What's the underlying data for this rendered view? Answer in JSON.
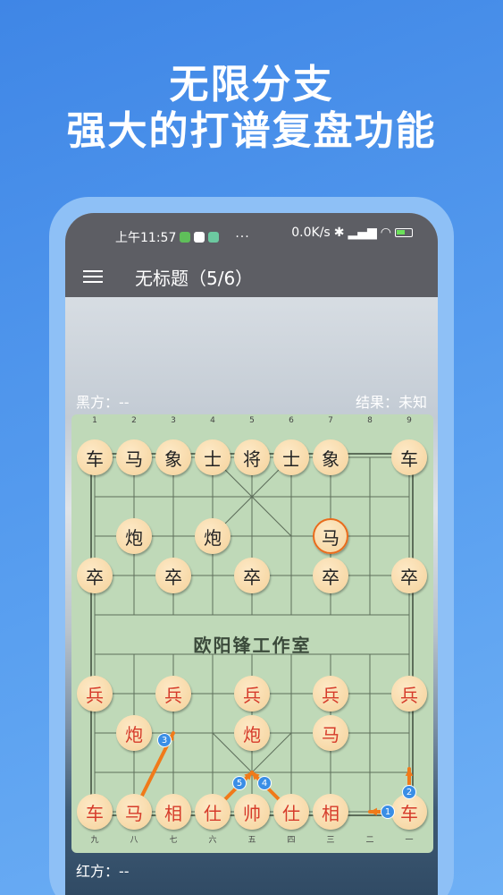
{
  "promo": {
    "line1": "无限分支",
    "line2": "强大的打谱复盘功能"
  },
  "statusbar": {
    "time": "上午11:57",
    "dots": "···",
    "speed": "0.0K/s"
  },
  "appbar": {
    "title": "无标题（5/6）"
  },
  "game": {
    "black_label": "黑方：--",
    "result_label": "结果：未知",
    "red_label": "红方：--",
    "river_text": "欧阳锋工作室"
  },
  "board": {
    "top_files": [
      "1",
      "2",
      "3",
      "4",
      "5",
      "6",
      "7",
      "8",
      "9"
    ],
    "bottom_files": [
      "九",
      "八",
      "七",
      "六",
      "五",
      "四",
      "三",
      "二",
      "一"
    ],
    "black_pieces": [
      {
        "char": "车",
        "file": 0,
        "rank": 0
      },
      {
        "char": "马",
        "file": 1,
        "rank": 0
      },
      {
        "char": "象",
        "file": 2,
        "rank": 0
      },
      {
        "char": "士",
        "file": 3,
        "rank": 0
      },
      {
        "char": "将",
        "file": 4,
        "rank": 0
      },
      {
        "char": "士",
        "file": 5,
        "rank": 0
      },
      {
        "char": "象",
        "file": 6,
        "rank": 0
      },
      {
        "char": "车",
        "file": 8,
        "rank": 0
      },
      {
        "char": "炮",
        "file": 1,
        "rank": 2
      },
      {
        "char": "炮",
        "file": 3,
        "rank": 2
      },
      {
        "char": "马",
        "file": 6,
        "rank": 2,
        "selected": true
      },
      {
        "char": "卒",
        "file": 0,
        "rank": 3
      },
      {
        "char": "卒",
        "file": 2,
        "rank": 3
      },
      {
        "char": "卒",
        "file": 4,
        "rank": 3
      },
      {
        "char": "卒",
        "file": 6,
        "rank": 3
      },
      {
        "char": "卒",
        "file": 8,
        "rank": 3
      }
    ],
    "red_pieces": [
      {
        "char": "兵",
        "file": 0,
        "rank": 6
      },
      {
        "char": "兵",
        "file": 2,
        "rank": 6
      },
      {
        "char": "兵",
        "file": 4,
        "rank": 6
      },
      {
        "char": "兵",
        "file": 6,
        "rank": 6
      },
      {
        "char": "兵",
        "file": 8,
        "rank": 6
      },
      {
        "char": "炮",
        "file": 1,
        "rank": 7
      },
      {
        "char": "炮",
        "file": 4,
        "rank": 7
      },
      {
        "char": "马",
        "file": 6,
        "rank": 7
      },
      {
        "char": "车",
        "file": 0,
        "rank": 9
      },
      {
        "char": "马",
        "file": 1,
        "rank": 9
      },
      {
        "char": "相",
        "file": 2,
        "rank": 9
      },
      {
        "char": "仕",
        "file": 3,
        "rank": 9
      },
      {
        "char": "帅",
        "file": 4,
        "rank": 9
      },
      {
        "char": "仕",
        "file": 5,
        "rank": 9
      },
      {
        "char": "相",
        "file": 6,
        "rank": 9
      },
      {
        "char": "车",
        "file": 8,
        "rank": 9
      }
    ],
    "move_markers": [
      "1",
      "2",
      "3",
      "4",
      "5"
    ],
    "colors": {
      "arrow": "#f07a1a",
      "marker": "#3a8ee6",
      "board": "#bfd9b8",
      "line": "#5d6e5a"
    }
  }
}
